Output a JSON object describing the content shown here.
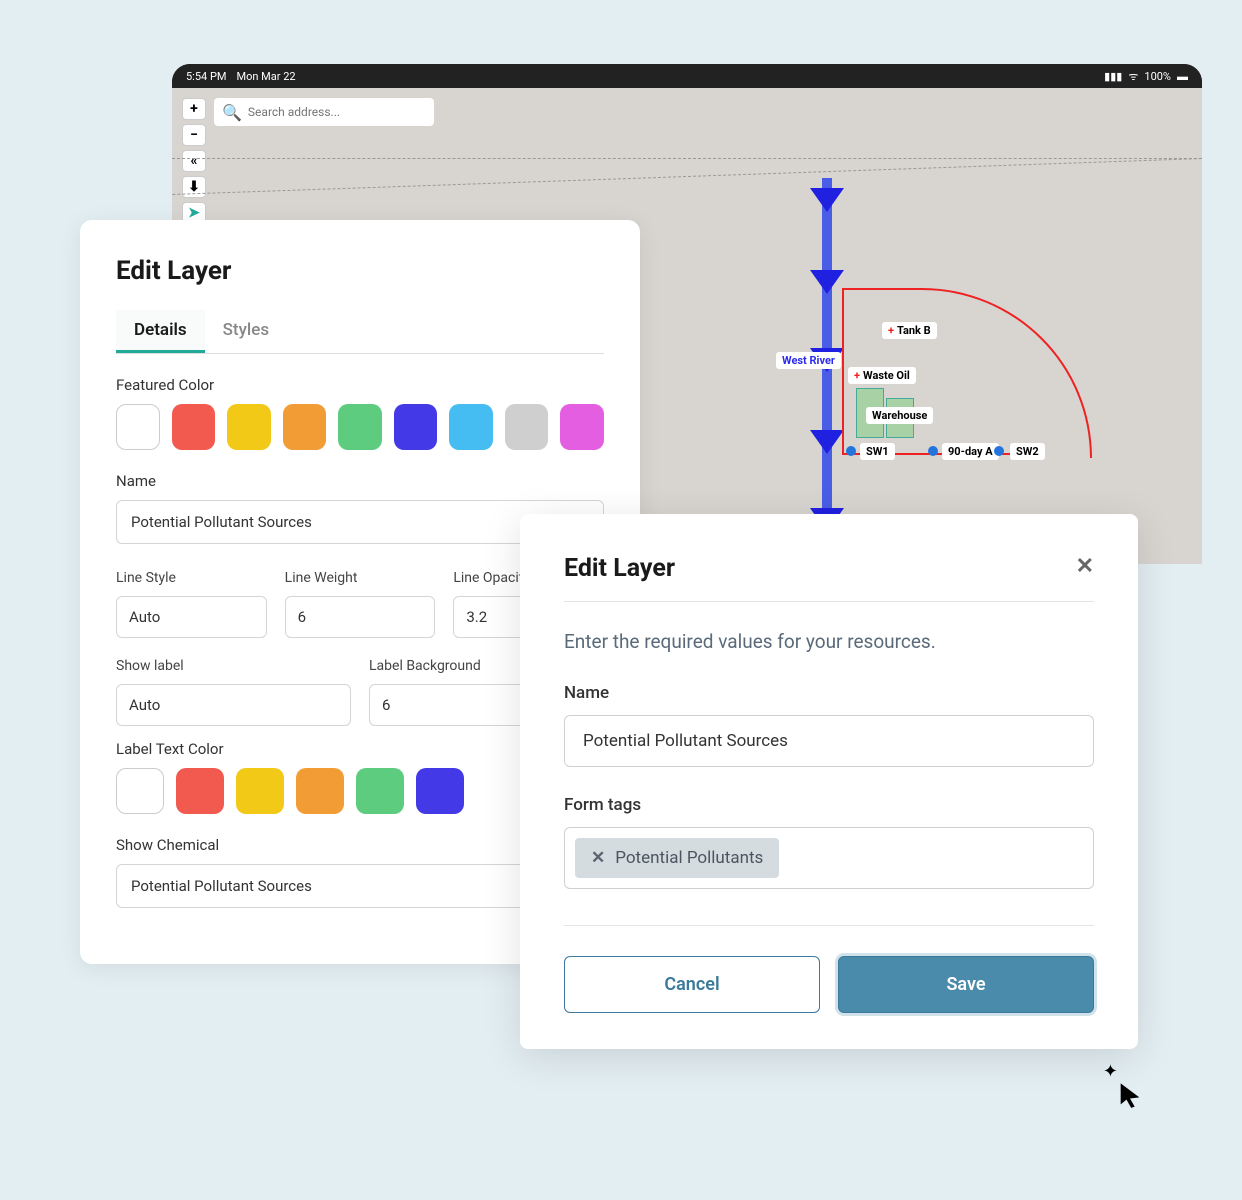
{
  "statusbar": {
    "time": "5:54 PM",
    "date": "Mon Mar 22",
    "battery": "100%",
    "signal_icon": "signal-icon",
    "wifi_icon": "wifi-icon"
  },
  "map": {
    "search_placeholder": "Search address...",
    "labels": {
      "west_river": "West River",
      "tank_b": "Tank B",
      "waste_oil": "Waste Oil",
      "warehouse": "Warehouse",
      "sw1": "SW1",
      "sw2": "SW2",
      "ninety_day": "90-day A"
    }
  },
  "panel_left": {
    "title": "Edit Layer",
    "tabs": {
      "details": "Details",
      "styles": "Styles"
    },
    "featured_color_label": "Featured Color",
    "swatches": [
      "#ffffff",
      "#f25a50",
      "#f2c917",
      "#f29c35",
      "#5ecc7f",
      "#4339e6",
      "#46bdf2",
      "#cfcfcf",
      "#e35ee0"
    ],
    "name_label": "Name",
    "name_value": "Potential Pollutant Sources",
    "line_style_label": "Line Style",
    "line_style_value": "Auto",
    "line_weight_label": "Line Weight",
    "line_weight_value": "6",
    "line_opacity_label": "Line Opacity",
    "line_opacity_value": "3.2",
    "show_label_label": "Show label",
    "show_label_value": "Auto",
    "label_bg_label": "Label Background",
    "label_bg_value": "6",
    "label_text_color_label": "Label Text Color",
    "label_swatches": [
      "#ffffff",
      "#f25a50",
      "#f2c917",
      "#f29c35",
      "#5ecc7f",
      "#4339e6"
    ],
    "show_chemical_label": "Show Chemical",
    "show_chemical_value": "Potential Pollutant Sources"
  },
  "panel_right": {
    "title": "Edit Layer",
    "subtitle": "Enter the required values for your resources.",
    "name_label": "Name",
    "name_value": "Potential Pollutant Sources",
    "formtags_label": "Form tags",
    "tag_text": "Potential Pollutants",
    "cancel_label": "Cancel",
    "save_label": "Save"
  }
}
